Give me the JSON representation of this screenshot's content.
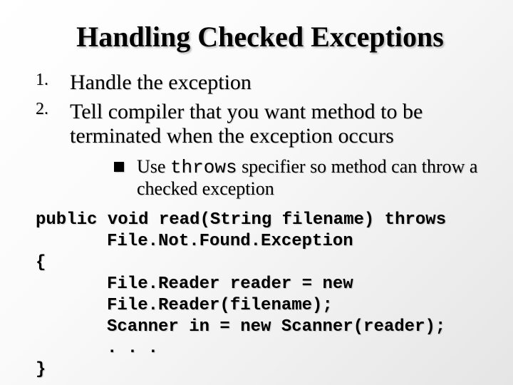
{
  "title": "Handling Checked Exceptions",
  "list": {
    "items": [
      {
        "num": "1.",
        "text": "Handle the exception"
      },
      {
        "num": "2.",
        "text": "Tell compiler that you want method to be terminated when the exception occurs"
      }
    ]
  },
  "sub": {
    "prefix": "Use ",
    "keyword": "throws",
    "suffix": " specifier so method can throw a checked exception"
  },
  "code": {
    "l1": "public void read(String filename) throws",
    "l2": "File.Not.Found.Exception",
    "l3": "{",
    "l4": "File.Reader reader = new",
    "l5": "File.Reader(filename);",
    "l6": "Scanner in = new Scanner(reader);",
    "l7": ". . .",
    "l8": "}"
  }
}
